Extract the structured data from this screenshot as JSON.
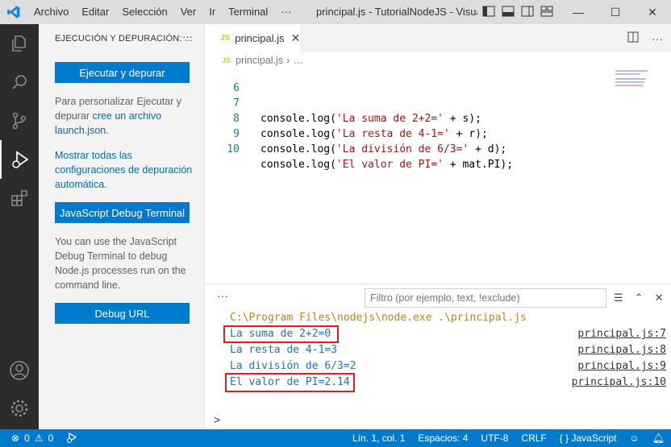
{
  "titlebar": {
    "menu": [
      "Archivo",
      "Editar",
      "Selección",
      "Ver",
      "Ir",
      "Terminal",
      "···"
    ],
    "title": "principal.js - TutorialNodeJS - Visual ...",
    "window_controls": [
      "minimize-icon",
      "maximize-icon",
      "close-icon"
    ]
  },
  "activity": {
    "items": [
      "explorer-icon",
      "search-icon",
      "source-control-icon",
      "run-debug-icon",
      "extensions-icon"
    ],
    "bottom": [
      "account-icon",
      "settings-gear-icon"
    ]
  },
  "sidebar": {
    "title": "EJECUCIÓN Y DEPURACIÓN: ...",
    "more": "···",
    "run_button": "Ejecutar y depurar",
    "customize_pre": "Para personalizar Ejecutar y depurar ",
    "customize_link": "cree un archivo launch.json",
    "customize_post": ".",
    "show_all_link": "Mostrar todas las configuraciones de depuración automática.",
    "js_terminal_button": "JavaScript Debug Terminal",
    "terminal_help": "You can use the JavaScript Debug Terminal to debug Node.js processes run on the command line.",
    "debug_url_button": "Debug URL"
  },
  "editor": {
    "tab_icon": "JS",
    "tab_label": "principal.js",
    "tab_close": "✕",
    "breadcrumb_file": "principal.js",
    "breadcrumb_more": "…",
    "lines": [
      {
        "num": "6",
        "pre": "",
        "str": "",
        "post": ""
      },
      {
        "num": "7",
        "pre": "console.log(",
        "str": "'La suma de 2+2='",
        "post": " + s);"
      },
      {
        "num": "8",
        "pre": "console.log(",
        "str": "'La resta de 4-1='",
        "post": " + r);"
      },
      {
        "num": "9",
        "pre": "console.log(",
        "str": "'La división de 6/3='",
        "post": " + d);"
      },
      {
        "num": "10",
        "pre": "console.log(",
        "str": "'El valor de PI='",
        "post": " + mat.PI);"
      }
    ]
  },
  "panel": {
    "more": "···",
    "filter_placeholder": "Filtro (por ejemplo, text, !exclude)",
    "command": "C:\\Program Files\\nodejs\\node.exe .\\principal.js",
    "outputs": [
      {
        "text": "La suma de 2+2=0",
        "ref": "principal.js:7",
        "highlighted": true
      },
      {
        "text": "La resta de 4-1=3",
        "ref": "principal.js:8",
        "highlighted": false
      },
      {
        "text": "La división de 6/3=2",
        "ref": "principal.js:9",
        "highlighted": false
      },
      {
        "text": "El valor de PI=2.14",
        "ref": "principal.js:10",
        "highlighted": true
      }
    ],
    "prompt": ">"
  },
  "status": {
    "errors": "0",
    "warnings": "0",
    "position": "Lín. 1, col. 1",
    "spaces": "Espacios: 4",
    "encoding": "UTF-8",
    "eol": "CRLF",
    "language_braces": "{ }",
    "language": "JavaScript"
  },
  "colors": {
    "accent": "#007acc",
    "activity_bg": "#2c2c2c",
    "highlight_box": "#e02020",
    "output_text": "#1f6fc4",
    "command_text": "#b8860b"
  }
}
